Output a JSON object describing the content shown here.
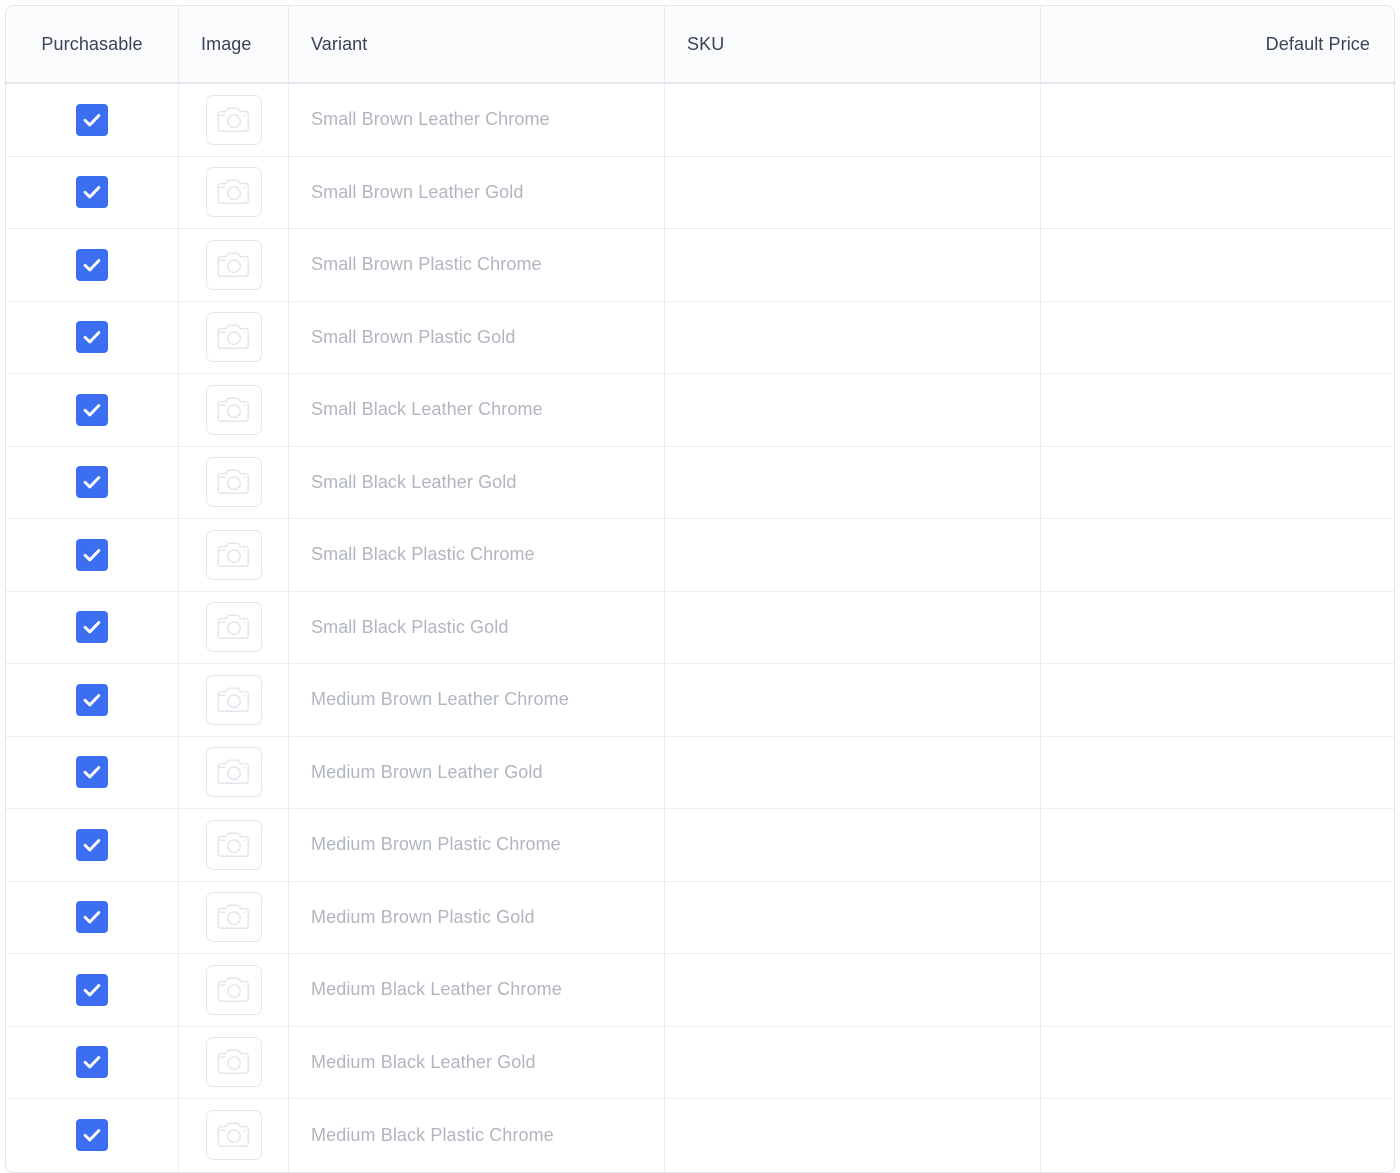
{
  "table": {
    "columns": [
      {
        "key": "purchasable",
        "label": "Purchasable",
        "align": "center"
      },
      {
        "key": "image",
        "label": "Image",
        "align": "left"
      },
      {
        "key": "variant",
        "label": "Variant",
        "align": "left"
      },
      {
        "key": "sku",
        "label": "SKU",
        "align": "left"
      },
      {
        "key": "default_price",
        "label": "Default Price",
        "align": "right"
      }
    ],
    "icons": {
      "checkbox_checked": "check-icon",
      "image_placeholder": "camera-icon"
    },
    "colors": {
      "checkbox_accent": "#3b6ef0",
      "checkbox_mark": "#ffffff",
      "header_bg": "#fafbfc",
      "header_text": "#3c4257",
      "variant_text": "#b0b5c0",
      "row_border": "#eceef2",
      "table_border": "#e2e6ec"
    },
    "rows": [
      {
        "purchasable": true,
        "variant": "Small Brown Leather Chrome",
        "sku": "",
        "default_price": ""
      },
      {
        "purchasable": true,
        "variant": "Small Brown Leather Gold",
        "sku": "",
        "default_price": ""
      },
      {
        "purchasable": true,
        "variant": "Small Brown Plastic Chrome",
        "sku": "",
        "default_price": ""
      },
      {
        "purchasable": true,
        "variant": "Small Brown Plastic Gold",
        "sku": "",
        "default_price": ""
      },
      {
        "purchasable": true,
        "variant": "Small Black Leather Chrome",
        "sku": "",
        "default_price": ""
      },
      {
        "purchasable": true,
        "variant": "Small Black Leather Gold",
        "sku": "",
        "default_price": ""
      },
      {
        "purchasable": true,
        "variant": "Small Black Plastic Chrome",
        "sku": "",
        "default_price": ""
      },
      {
        "purchasable": true,
        "variant": "Small Black Plastic Gold",
        "sku": "",
        "default_price": ""
      },
      {
        "purchasable": true,
        "variant": "Medium Brown Leather Chrome",
        "sku": "",
        "default_price": ""
      },
      {
        "purchasable": true,
        "variant": "Medium Brown Leather Gold",
        "sku": "",
        "default_price": ""
      },
      {
        "purchasable": true,
        "variant": "Medium Brown Plastic Chrome",
        "sku": "",
        "default_price": ""
      },
      {
        "purchasable": true,
        "variant": "Medium Brown Plastic Gold",
        "sku": "",
        "default_price": ""
      },
      {
        "purchasable": true,
        "variant": "Medium Black Leather Chrome",
        "sku": "",
        "default_price": ""
      },
      {
        "purchasable": true,
        "variant": "Medium Black Leather Gold",
        "sku": "",
        "default_price": ""
      },
      {
        "purchasable": true,
        "variant": "Medium Black Plastic Chrome",
        "sku": "",
        "default_price": ""
      }
    ]
  }
}
